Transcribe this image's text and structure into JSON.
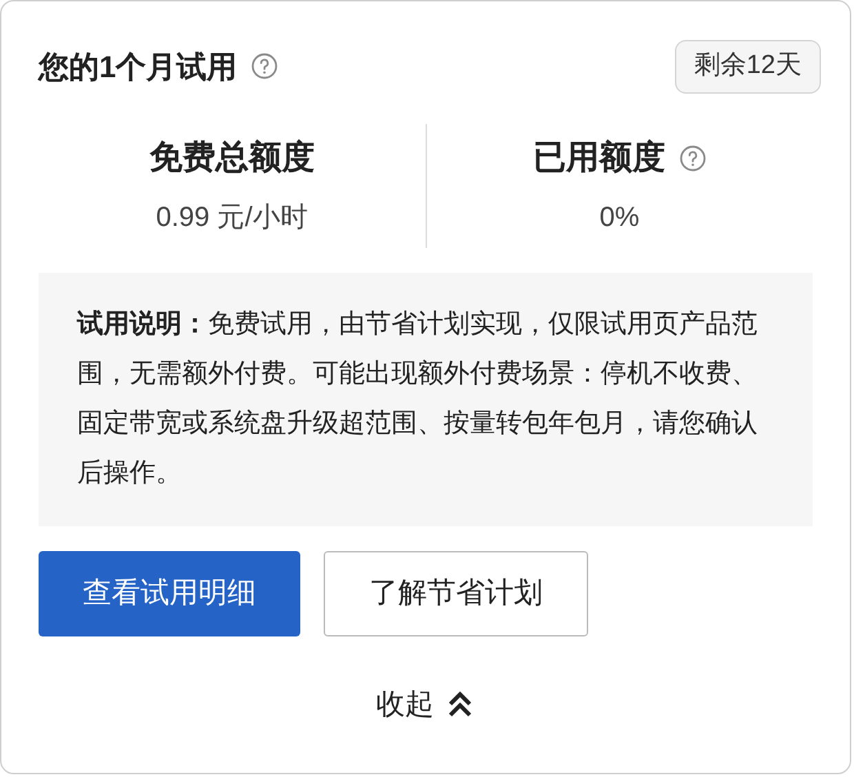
{
  "title": "您的1个月试用",
  "badge": "剩余12天",
  "stats": [
    {
      "label": "免费总额度",
      "value": "0.99 元/小时",
      "help": false
    },
    {
      "label": "已用额度",
      "value": "0%",
      "help": true
    }
  ],
  "note": "**试用说明：**免费试用，由节省计划实现，仅限试用页产品范围，无需额外付费。可能出现额外付费场景：停机不收费、固定带宽或系统盘升级超范围、按量转包年包月，请您确认后操作。",
  "buttons": [
    {
      "label": "查看试用明细",
      "kind": "primary"
    },
    {
      "label": "了解节省计划",
      "kind": "secondary"
    }
  ],
  "collapse": "收起"
}
